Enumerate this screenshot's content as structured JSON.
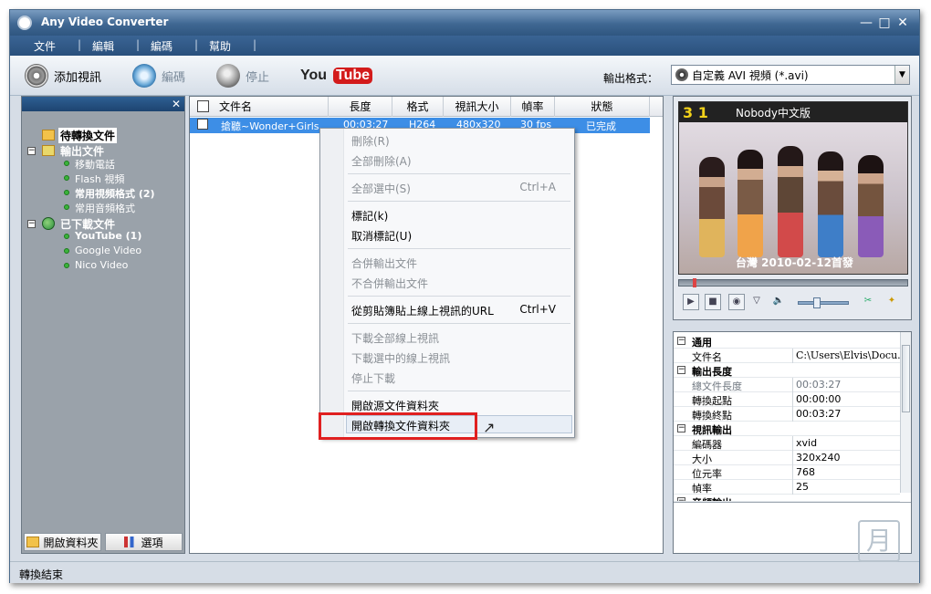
{
  "window": {
    "title": "Any Video Converter",
    "controls": [
      "minimize-icon",
      "maximize-icon",
      "close-icon"
    ]
  },
  "menu": {
    "items": [
      "文件",
      "編輯",
      "編碼",
      "幫助"
    ]
  },
  "toolbar": {
    "add_video": "添加視訊",
    "encode": "編碼",
    "stop": "停止",
    "youtube_you": "You",
    "youtube_tube": "Tube",
    "output_format_label": "輸出格式：",
    "output_format_value": "自定義 AVI 視頻 (*.avi)"
  },
  "sidebar": {
    "tree": [
      {
        "label": "待轉換文件",
        "level": 0
      },
      {
        "label": "輸出文件",
        "level": 0
      },
      {
        "label": "移動電話",
        "level": 1
      },
      {
        "label": "Flash 視頻",
        "level": 1
      },
      {
        "label": "常用視頻格式 (2)",
        "level": 1
      },
      {
        "label": "常用音頻格式",
        "level": 1
      },
      {
        "label": "已下載文件",
        "level": 0
      },
      {
        "label": "YouTube (1)",
        "level": 1
      },
      {
        "label": "Google Video",
        "level": 1
      },
      {
        "label": "Nico Video",
        "level": 1
      }
    ],
    "open_folder": "開啟資料夾",
    "options": "選項"
  },
  "file_list": {
    "columns": [
      "文件名",
      "長度",
      "格式",
      "視訊大小",
      "幀率",
      "狀態"
    ],
    "rows": [
      {
        "name": "搶聽~Wonder+Girls...",
        "length": "00:03:27",
        "format": "H264",
        "size": "480x320",
        "fps": "30 fps",
        "status": "已完成"
      }
    ]
  },
  "context_menu": {
    "items": [
      {
        "label": "刪除(R)",
        "enabled": false
      },
      {
        "label": "全部刪除(A)",
        "enabled": false
      },
      {
        "label": "全部選中(S)",
        "enabled": false,
        "shortcut": "Ctrl+A"
      },
      {
        "label": "標記(k)",
        "enabled": true
      },
      {
        "label": "取消標記(U)",
        "enabled": true
      },
      {
        "label": "合併輸出文件",
        "enabled": false
      },
      {
        "label": "不合併輸出文件",
        "enabled": false
      },
      {
        "label": "從剪貼簿貼上線上視訊的URL",
        "enabled": true,
        "shortcut": "Ctrl+V"
      },
      {
        "label": "下載全部線上視訊",
        "enabled": false
      },
      {
        "label": "下載選中的線上視訊",
        "enabled": false
      },
      {
        "label": "停止下載",
        "enabled": false
      },
      {
        "label": "開啟源文件資料夾",
        "enabled": true
      },
      {
        "label": "開啟轉換文件資料夾",
        "enabled": true,
        "highlighted": true
      }
    ]
  },
  "preview": {
    "caption_top": "Nobody中文版",
    "caption_bottom": "台灣 2010-02-12首發",
    "counter": "3 1"
  },
  "properties": {
    "rows": [
      {
        "type": "cat",
        "key": "通用"
      },
      {
        "type": "item",
        "key": "文件名",
        "value": "C:\\Users\\Elvis\\Docu..."
      },
      {
        "type": "cat",
        "key": "輸出長度"
      },
      {
        "type": "item",
        "key": "總文件長度",
        "value": "00:03:27",
        "dim": true
      },
      {
        "type": "item",
        "key": "轉換起點",
        "value": "00:00:00"
      },
      {
        "type": "item",
        "key": "轉換終點",
        "value": "00:03:27"
      },
      {
        "type": "cat",
        "key": "視訊輸出"
      },
      {
        "type": "item",
        "key": "編碼器",
        "value": "xvid"
      },
      {
        "type": "item",
        "key": "大小",
        "value": "320x240"
      },
      {
        "type": "item",
        "key": "位元率",
        "value": "768"
      },
      {
        "type": "item",
        "key": "幀率",
        "value": "25"
      },
      {
        "type": "cat",
        "key": "音頻輸出"
      }
    ]
  },
  "status": {
    "text": "轉換結束"
  },
  "colors": {
    "title_bar": "#3f6792",
    "selection": "#3d8ee6",
    "highlight_border": "#e02020"
  }
}
